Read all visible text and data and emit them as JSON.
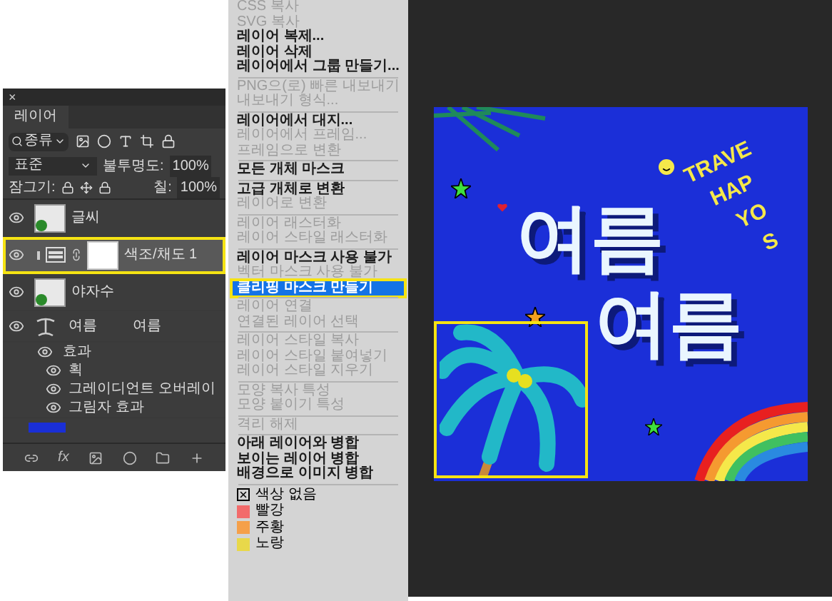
{
  "layers_panel": {
    "close": "×",
    "tab": "레이어",
    "filter": {
      "value": "종류"
    },
    "blend": {
      "value": "표준"
    },
    "opacity": {
      "label": "불투명도:",
      "value": "100%"
    },
    "lock": {
      "label": "잠그기:"
    },
    "fill": {
      "label": "칠:",
      "value": "100%"
    },
    "layers": [
      {
        "kind": "image",
        "name": "글씨",
        "visible": true,
        "selected": false,
        "highlighted": false
      },
      {
        "kind": "adjustment",
        "name": "색조/채도 1",
        "visible": true,
        "selected": true,
        "highlighted": true
      },
      {
        "kind": "image",
        "name": "야자수",
        "visible": true,
        "selected": false,
        "highlighted": false
      },
      {
        "kind": "text",
        "name": "여름 여름",
        "visible": true,
        "selected": false,
        "highlighted": false,
        "effects": {
          "label": "효과",
          "visible": true,
          "children": [
            {
              "name": "획",
              "visible": true
            },
            {
              "name": "그레이디언트 오버레이",
              "visible": true
            },
            {
              "name": "그림자 효과",
              "visible": true
            }
          ]
        }
      },
      {
        "kind": "fill"
      }
    ],
    "footer": {
      "fx": "fx"
    }
  },
  "context_menu": [
    {
      "kind": "item",
      "label": "CSS 복사",
      "disabled": true,
      "selected": false
    },
    {
      "kind": "item",
      "label": "SVG 복사",
      "disabled": true,
      "selected": false
    },
    {
      "kind": "item",
      "label": "레이어 복제...",
      "disabled": false,
      "selected": false
    },
    {
      "kind": "item",
      "label": "레이어 삭제",
      "disabled": false,
      "selected": false
    },
    {
      "kind": "item",
      "label": "레이어에서 그룹 만들기...",
      "disabled": false,
      "selected": false
    },
    {
      "kind": "separator"
    },
    {
      "kind": "item",
      "label": "PNG으(로) 빠른 내보내기",
      "disabled": true,
      "selected": false
    },
    {
      "kind": "item",
      "label": "내보내기 형식...",
      "disabled": true,
      "selected": false
    },
    {
      "kind": "separator"
    },
    {
      "kind": "item",
      "label": "레이어에서 대지...",
      "disabled": false,
      "selected": false
    },
    {
      "kind": "item",
      "label": "레이어에서 프레임...",
      "disabled": true,
      "selected": false
    },
    {
      "kind": "item",
      "label": "프레임으로 변환",
      "disabled": true,
      "selected": false
    },
    {
      "kind": "separator"
    },
    {
      "kind": "item",
      "label": "모든 개체 마스크",
      "disabled": false,
      "selected": false
    },
    {
      "kind": "separator"
    },
    {
      "kind": "item",
      "label": "고급 개체로 변환",
      "disabled": false,
      "selected": false
    },
    {
      "kind": "item",
      "label": "레이어로 변환",
      "disabled": true,
      "selected": false
    },
    {
      "kind": "separator"
    },
    {
      "kind": "item",
      "label": "레이어 래스터화",
      "disabled": true,
      "selected": false
    },
    {
      "kind": "item",
      "label": "레이어 스타일 래스터화",
      "disabled": true,
      "selected": false
    },
    {
      "kind": "separator"
    },
    {
      "kind": "item",
      "label": "레이어 마스크 사용 불가",
      "disabled": false,
      "selected": false
    },
    {
      "kind": "item",
      "label": "벡터 마스크 사용 불가",
      "disabled": true,
      "selected": false
    },
    {
      "kind": "item",
      "label": "클리핑 마스크 만들기",
      "disabled": false,
      "selected": true
    },
    {
      "kind": "separator"
    },
    {
      "kind": "item",
      "label": "레이어 연결",
      "disabled": true,
      "selected": false
    },
    {
      "kind": "item",
      "label": "연결된 레이어 선택",
      "disabled": true,
      "selected": false
    },
    {
      "kind": "separator"
    },
    {
      "kind": "item",
      "label": "레이어 스타일 복사",
      "disabled": true,
      "selected": false
    },
    {
      "kind": "item",
      "label": "레이어 스타일 붙여넣기",
      "disabled": true,
      "selected": false
    },
    {
      "kind": "item",
      "label": "레이어 스타일 지우기",
      "disabled": true,
      "selected": false
    },
    {
      "kind": "separator"
    },
    {
      "kind": "item",
      "label": "모양 복사 특성",
      "disabled": true,
      "selected": false
    },
    {
      "kind": "item",
      "label": "모양 붙이기 특성",
      "disabled": true,
      "selected": false
    },
    {
      "kind": "separator"
    },
    {
      "kind": "item",
      "label": "격리 해제",
      "disabled": true,
      "selected": false
    },
    {
      "kind": "separator"
    },
    {
      "kind": "item",
      "label": "아래 레이어와 병합",
      "disabled": false,
      "selected": false
    },
    {
      "kind": "item",
      "label": "보이는 레이어 병합",
      "disabled": false,
      "selected": false
    },
    {
      "kind": "item",
      "label": "배경으로 이미지 병합",
      "disabled": false,
      "selected": false
    },
    {
      "kind": "separator"
    },
    {
      "kind": "none",
      "label": "색상 없음"
    },
    {
      "kind": "color",
      "label": "빨강",
      "color": "#f26b6b"
    },
    {
      "kind": "color",
      "label": "주황",
      "color": "#f5a04a"
    },
    {
      "kind": "color",
      "label": "노랑",
      "color": "#e8d84a"
    }
  ],
  "canvas": {
    "title_lines": [
      "여름",
      "여름"
    ],
    "slogan_lines": [
      "TRAVE",
      "HAP",
      "YO",
      "S"
    ],
    "selection_visible": true
  }
}
